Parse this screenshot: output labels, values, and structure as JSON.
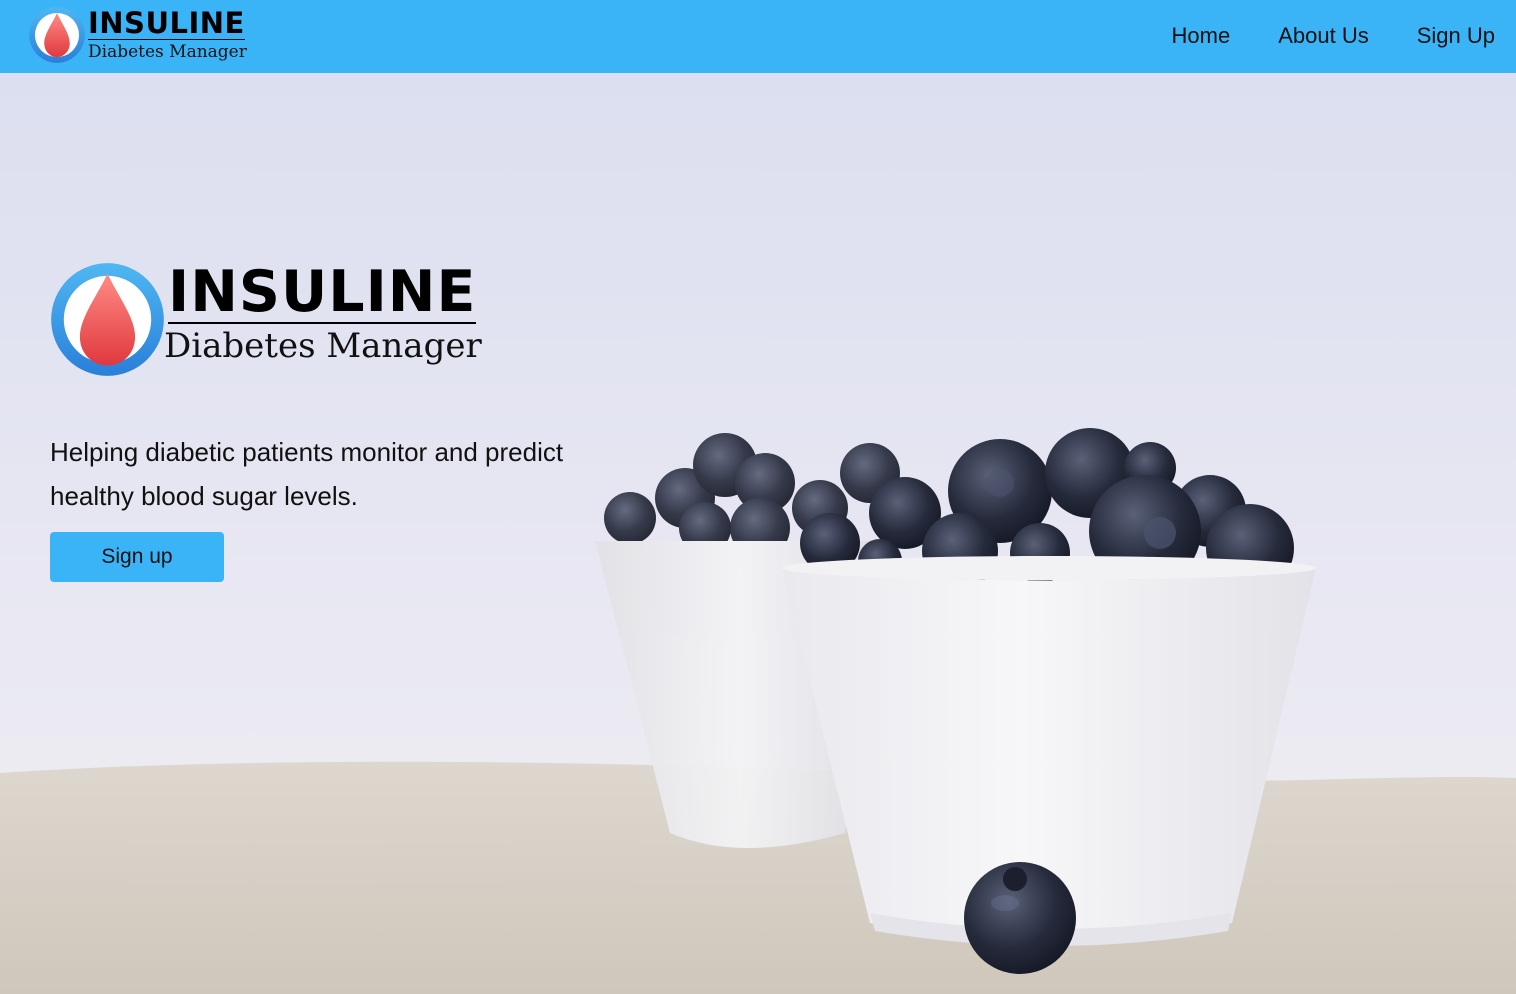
{
  "navbar": {
    "logo": {
      "title": "INSULINE",
      "subtitle": "Diabetes Manager"
    },
    "links": [
      {
        "label": "Home"
      },
      {
        "label": "About Us"
      },
      {
        "label": "Sign Up"
      }
    ],
    "background_color": "#3bb4f7"
  },
  "hero": {
    "logo": {
      "title": "INSULINE",
      "subtitle": "Diabetes Manager"
    },
    "tagline": "Helping diabetic patients monitor and predict healthy blood sugar levels.",
    "cta_label": "Sign up",
    "background_image": "two white bowls of blueberries on linen cloth",
    "accent_color": "#3bb4f7"
  },
  "icons": {
    "logo_icon": "blood-drop-icon"
  }
}
